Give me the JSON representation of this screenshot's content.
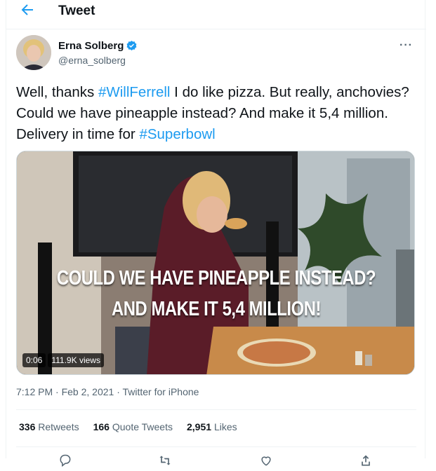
{
  "header": {
    "title": "Tweet"
  },
  "author": {
    "name": "Erna Solberg",
    "handle": "@erna_solberg"
  },
  "tweet": {
    "text_parts": [
      {
        "text": "Well, thanks ",
        "hashtag": false
      },
      {
        "text": "#WillFerrell",
        "hashtag": true
      },
      {
        "text": " I do like pizza. But really, anchovies? Could we have pineapple instead? And make it 5,4 million. Delivery in time for ",
        "hashtag": false
      },
      {
        "text": "#Superbowl",
        "hashtag": true
      }
    ]
  },
  "media": {
    "caption_line1": "COULD WE HAVE PINEAPPLE INSTEAD?",
    "caption_line2": "AND MAKE IT 5,4 MILLION!",
    "duration": "0:06",
    "views": "111.9K views"
  },
  "meta": {
    "timestamp": "7:12 PM · Feb 2, 2021 · Twitter for iPhone"
  },
  "stats": {
    "retweets_count": "336",
    "retweets_label": "Retweets",
    "quotes_count": "166",
    "quotes_label": "Quote Tweets",
    "likes_count": "2,951",
    "likes_label": "Likes"
  },
  "colors": {
    "accent": "#1d9bf0",
    "muted": "#536471",
    "text": "#0f1419"
  },
  "icons": [
    "back-arrow-icon",
    "verified-badge-icon",
    "more-options-icon",
    "reply-icon",
    "retweet-icon",
    "like-icon",
    "share-icon"
  ]
}
